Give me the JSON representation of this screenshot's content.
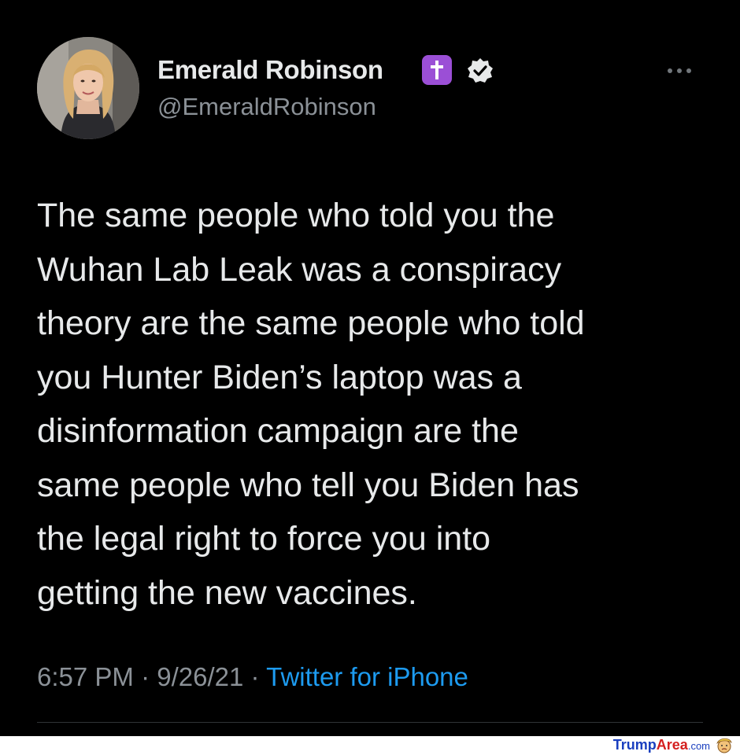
{
  "author": {
    "display_name": "Emerald Robinson",
    "handle": "@EmeraldRobinson",
    "badges": [
      "cross-badge-icon",
      "verified-icon"
    ],
    "badge_color": "#9b4fd6"
  },
  "tweet": {
    "lines": [
      "The same people who told you the",
      "Wuhan Lab Leak was a conspiracy",
      "theory are the same people who told",
      "you Hunter Biden’s laptop was a",
      "disinformation campaign are the",
      "same people who tell you Biden has",
      "the legal right to force you into",
      "getting the new vaccines."
    ]
  },
  "meta": {
    "time": "6:57 PM",
    "date": "9/26/21",
    "separator": "·",
    "source": "Twitter for iPhone",
    "source_color": "#1d9bf0"
  },
  "watermark": {
    "part1": "Trump",
    "part2": "Area",
    "part3": ".com"
  },
  "theme": {
    "background": "#000000",
    "text": "#e7e9ea",
    "secondary": "#8b9197"
  }
}
